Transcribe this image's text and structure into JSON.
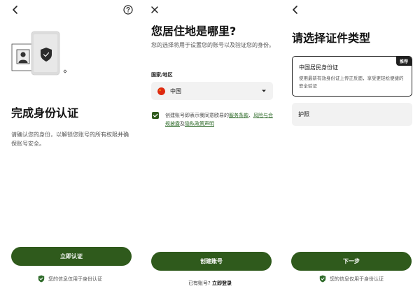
{
  "screen1": {
    "title": "完成身份认证",
    "description": "请确认您的身份，以解锁您账号的所有权限并确保账号安全。",
    "primary_button": "立即认证",
    "footnote": "您的信息仅用于身份认证"
  },
  "screen2": {
    "title": "您居住地是哪里?",
    "description": "您的选择将用于设置您的账号以及验证您的身份。",
    "field_label": "国家/地区",
    "country_value": "中国",
    "consent_prefix": "创建账号即表示我同意欧易的",
    "consent_link_terms": "服务条款",
    "consent_sep1": "、",
    "consent_link_risk": "风险与合规披露",
    "consent_sep2": "及",
    "consent_link_privacy": "隐私政策声明",
    "primary_button": "创建账号",
    "login_prompt": "已有账号?",
    "login_link": "立即登录"
  },
  "screen3": {
    "title": "请选择证件类型",
    "option1_title": "中国居民身份证",
    "option1_desc": "使用最新有效身份证上传正反面，享受更轻松便捷的安全验证",
    "option1_badge": "推荐",
    "option2_title": "护照",
    "primary_button": "下一步",
    "footnote": "您的信息仅用于身份认证"
  },
  "colors": {
    "primary": "#2f5a1c",
    "link": "#2f6b2a",
    "selected_border": "#222222",
    "card_bg": "#f2f2f2"
  }
}
